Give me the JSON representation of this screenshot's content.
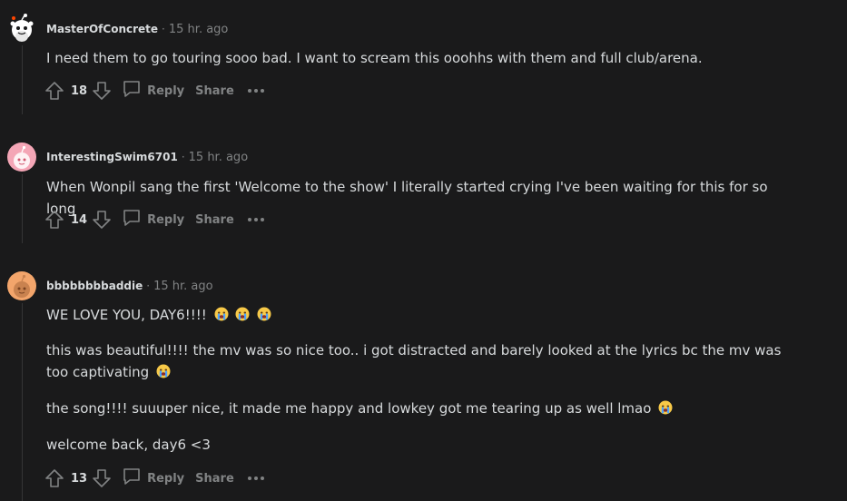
{
  "comments": [
    {
      "author": "MasterOfConcrete",
      "time": "15 hr. ago",
      "paragraphs": [
        "I need them to go touring sooo bad. I want to scream this ooohhs with them and full club/arena."
      ],
      "score": "18",
      "reply_label": "Reply",
      "share_label": "Share",
      "avatar_icon": "snoo-avatar-icon"
    },
    {
      "author": "InterestingSwim6701",
      "time": "15 hr. ago",
      "paragraphs": [
        "When Wonpil sang the first 'Welcome to the show' I literally started crying I've been waiting for this for so long"
      ],
      "score": "14",
      "reply_label": "Reply",
      "share_label": "Share",
      "avatar_icon": "pink-snoo-avatar-icon"
    },
    {
      "author": "bbbbbbbbaddie",
      "time": "15 hr. ago",
      "paragraphs": [
        "WE LOVE YOU, DAY6!!!!",
        "this was beautiful!!!! the mv was so nice too.. i got distracted and barely looked at the lyrics bc the mv was too captivating",
        "the song!!!! suuuper nice, it made me happy and lowkey got me tearing up as well lmao",
        "welcome back, day6 <3"
      ],
      "score": "13",
      "reply_label": "Reply",
      "share_label": "Share",
      "avatar_icon": "orange-snoo-avatar-icon"
    }
  ],
  "colors": {
    "background": "#1a1a1b",
    "text": "#d7dadc",
    "muted": "#818384",
    "thread_line": "#343536"
  },
  "icons": {
    "upvote": "upvote-arrow-icon",
    "downvote": "downvote-arrow-icon",
    "reply": "speech-bubble-icon",
    "more": "ellipsis-icon",
    "emoji": "loudly-crying-face-emoji"
  }
}
